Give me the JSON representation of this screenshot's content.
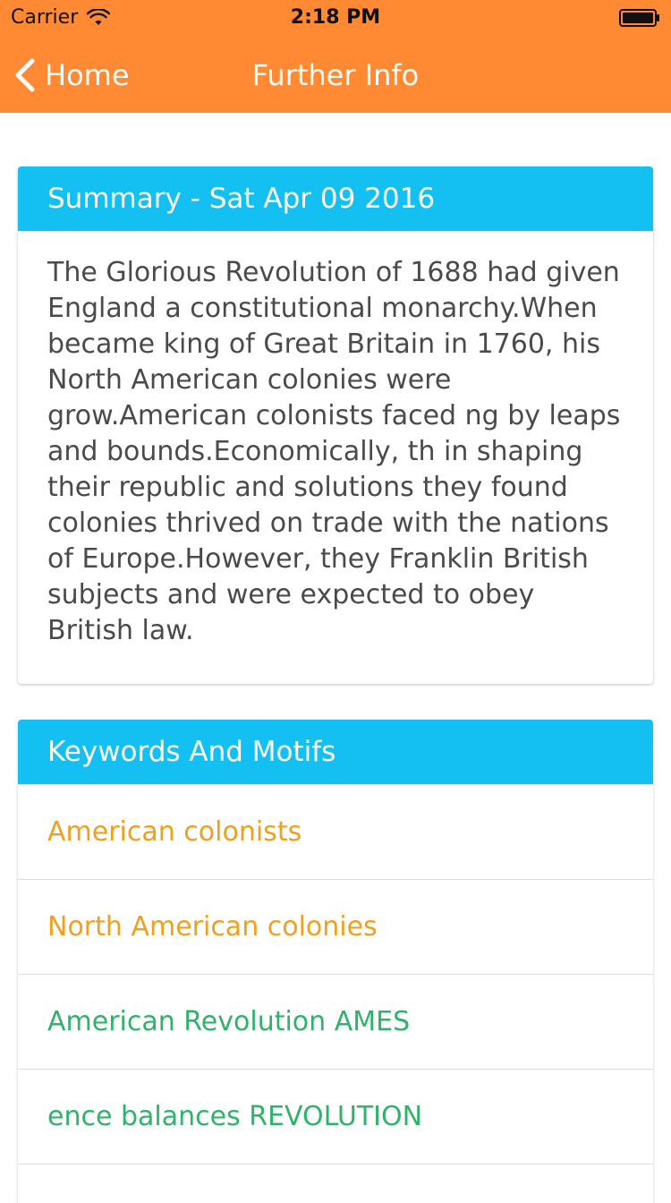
{
  "status_bar": {
    "carrier": "Carrier",
    "time": "2:18 PM",
    "icons": [
      "wifi-icon",
      "battery-icon"
    ]
  },
  "nav": {
    "back_label": "Home",
    "title": "Further Info",
    "icons": [
      "chevron-left-icon"
    ]
  },
  "summary": {
    "header": "Summary - Sat Apr 09 2016",
    "text": "The Glorious Revolution of 1688 had given England a constitutional monarchy.When became king of Great Britain in 1760, his North American colonies were grow.American colonists faced ng by leaps and bounds.Economically, th in shaping their republic and solutions they found colonies thrived on trade with the nations of Europe.However, they Franklin British subjects and were expected to obey British law."
  },
  "keywords": {
    "header": "Keywords And Motifs",
    "items": [
      {
        "label": "American colonists",
        "color": "#f0a020"
      },
      {
        "label": "North American colonies",
        "color": "#f0a020"
      },
      {
        "label": "American Revolution AMES",
        "color": "#2fb36a"
      },
      {
        "label": "ence balances REVOLUTION",
        "color": "#2fb36a"
      }
    ]
  },
  "colors": {
    "nav_bar": "#ff8a33",
    "card_header": "#14c0f2",
    "keyword_orange": "#f0a020",
    "keyword_green": "#2fb36a"
  }
}
